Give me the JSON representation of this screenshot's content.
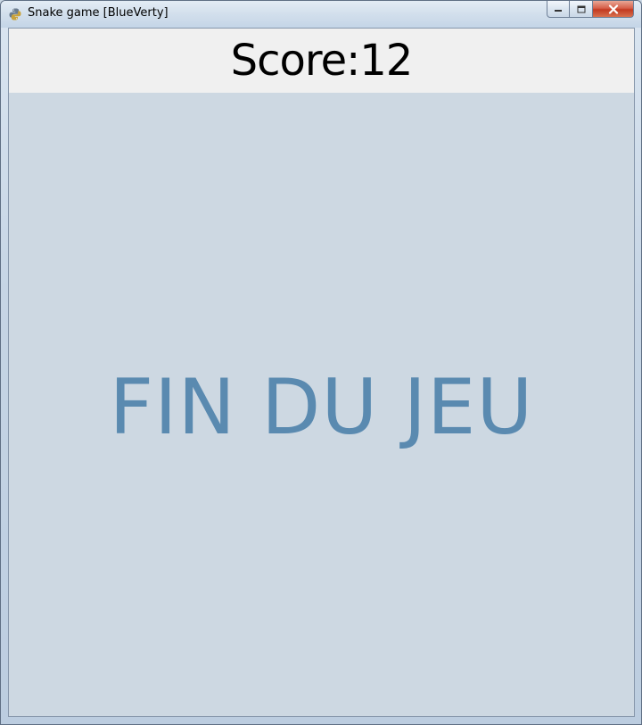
{
  "window": {
    "title": "Snake game [BlueVerty]",
    "icon": "python-icon"
  },
  "controls": {
    "minimize_icon": "minimize-icon",
    "maximize_icon": "maximize-icon",
    "close_icon": "close-icon"
  },
  "game": {
    "score_label": "Score:12",
    "game_over_text": "FIN DU JEU"
  },
  "colors": {
    "board_background": "#cdd8e2",
    "score_background": "#f0f0f0",
    "game_over_text": "#5a8ab0"
  }
}
